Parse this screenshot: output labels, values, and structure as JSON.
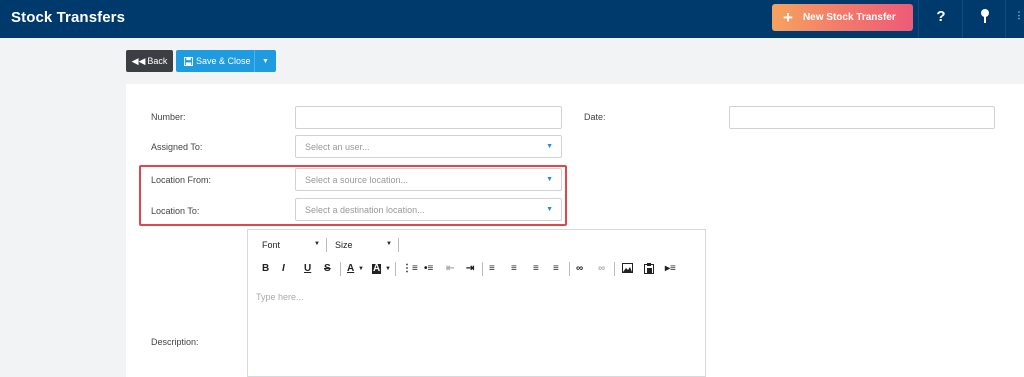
{
  "header": {
    "title": "Stock Transfers",
    "new_button_label": "New Stock Transfer",
    "help_icon": "?",
    "pin_icon": "pin-icon"
  },
  "actions": {
    "back_label": "Back",
    "save_label": "Save & Close"
  },
  "form": {
    "number_label": "Number:",
    "number_value": "",
    "date_label": "Date:",
    "date_value": "",
    "assigned_label": "Assigned To:",
    "assigned_placeholder": "Select an user...",
    "location_from_label": "Location From:",
    "location_from_placeholder": "Select a source location...",
    "location_to_label": "Location To:",
    "location_to_placeholder": "Select a destination location...",
    "description_label": "Description:"
  },
  "editor": {
    "font_label": "Font",
    "size_label": "Size",
    "placeholder": "Type here..."
  },
  "colors": {
    "topbar": "#003a6c",
    "accent_blue": "#1f9be0",
    "highlight_red": "#e0474c"
  }
}
